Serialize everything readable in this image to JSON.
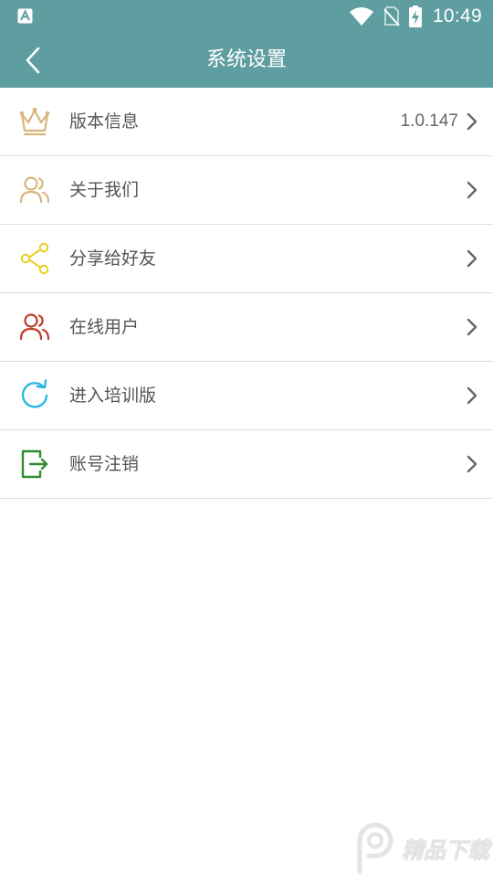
{
  "status_bar": {
    "time": "10:49",
    "notification_icon": "font-a-icon",
    "icons": [
      "wifi-icon",
      "no-sim-icon",
      "battery-charging-icon"
    ]
  },
  "toolbar": {
    "title": "系统设置",
    "back_icon": "chevron-left-icon"
  },
  "menu": [
    {
      "label": "版本信息",
      "value": "1.0.147",
      "icon": "crown-icon",
      "icon_color": "#d8b67b"
    },
    {
      "label": "关于我们",
      "icon": "users-icon",
      "icon_color": "#d8b67b"
    },
    {
      "label": "分享给好友",
      "icon": "share-icon",
      "icon_color": "#e8cf22"
    },
    {
      "label": "在线用户",
      "icon": "users-icon",
      "icon_color": "#c0392b"
    },
    {
      "label": "进入培训版",
      "icon": "refresh-icon",
      "icon_color": "#29b6e0"
    },
    {
      "label": "账号注销",
      "icon": "logout-icon",
      "icon_color": "#2e8b2e"
    }
  ],
  "colors": {
    "header": "#5f9ea0",
    "divider": "#dcdcdc",
    "label_text": "#555555",
    "chevron": "#666666"
  },
  "watermark": {
    "text": "精品下载",
    "icon": "p-logo-icon"
  }
}
